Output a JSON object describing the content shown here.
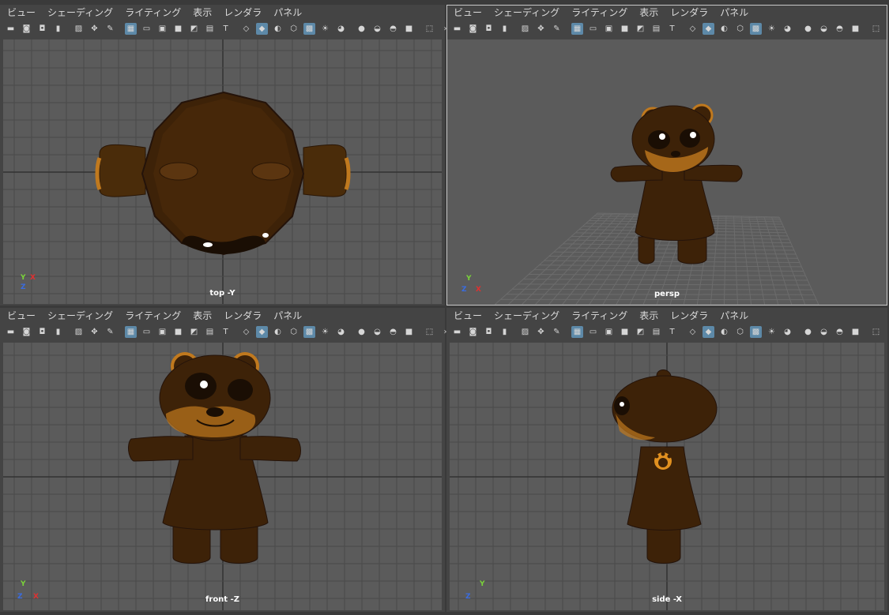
{
  "menu": [
    "ビュー",
    "シェーディング",
    "ライティング",
    "表示",
    "レンダラ",
    "パネル"
  ],
  "toolbar_icons": [
    {
      "name": "camera-icon",
      "glyph": "▬",
      "on": false
    },
    {
      "name": "camera-attributes-icon",
      "glyph": "◙",
      "on": false
    },
    {
      "name": "camera-lock-icon",
      "glyph": "◘",
      "on": false
    },
    {
      "name": "bookmark-icon",
      "glyph": "▮",
      "on": false
    },
    {
      "sep": true
    },
    {
      "name": "image-plane-icon",
      "glyph": "▨",
      "on": false
    },
    {
      "name": "pan-zoom-icon",
      "glyph": "✥",
      "on": false
    },
    {
      "name": "grease-pencil-icon",
      "glyph": "✎",
      "on": false
    },
    {
      "sep": true
    },
    {
      "name": "grid-icon",
      "glyph": "▦",
      "on": true
    },
    {
      "name": "film-gate-icon",
      "glyph": "▭",
      "on": false
    },
    {
      "name": "resolution-gate-icon",
      "glyph": "▣",
      "on": false
    },
    {
      "name": "gate-mask-icon",
      "glyph": "■",
      "on": false
    },
    {
      "name": "field-chart-icon",
      "glyph": "◩",
      "on": false
    },
    {
      "name": "safe-action-icon",
      "glyph": "▤",
      "on": false
    },
    {
      "name": "safe-title-icon",
      "glyph": "T",
      "on": false
    },
    {
      "sep": true
    },
    {
      "name": "wireframe-icon",
      "glyph": "◇",
      "on": false
    },
    {
      "name": "smooth-shade-icon",
      "glyph": "◆",
      "on": true
    },
    {
      "name": "default-material-icon",
      "glyph": "◐",
      "on": false
    },
    {
      "name": "wireframe-on-shaded-icon",
      "glyph": "⬡",
      "on": false
    },
    {
      "name": "textured-icon",
      "glyph": "▩",
      "on": true
    },
    {
      "name": "use-all-lights-icon",
      "glyph": "☀",
      "on": false
    },
    {
      "name": "shadows-icon",
      "glyph": "◕",
      "on": false
    },
    {
      "sep": true
    },
    {
      "name": "isolate-select-icon",
      "glyph": "●",
      "on": false
    },
    {
      "name": "xray-icon",
      "glyph": "◒",
      "on": false
    },
    {
      "name": "xray-joints-icon",
      "glyph": "◓",
      "on": false
    },
    {
      "name": "xray-active-components-icon",
      "glyph": "■",
      "on": false
    },
    {
      "sep": true
    },
    {
      "name": "select-camera-icon",
      "glyph": "⬚",
      "on": false
    },
    {
      "name": "more-icon",
      "glyph": "›",
      "on": false
    }
  ],
  "panels": {
    "top": {
      "label": "top -Y",
      "axis": {
        "up": "Y",
        "right": "X",
        "down": "Z"
      }
    },
    "persp": {
      "label": "persp",
      "axis": {
        "up": "Y",
        "right": "X",
        "down": "Z"
      }
    },
    "front": {
      "label": "front -Z",
      "axis": {
        "up": "Y",
        "right": "X",
        "down": "Z"
      }
    },
    "side": {
      "label": "side -X",
      "axis": {
        "up": "Y",
        "right": "",
        "down": "Z"
      }
    }
  },
  "colors": {
    "viewport_bg": "#5b5b5b",
    "grid": "#4a4a4a",
    "grid_axis": "#333333",
    "fur_dark": "#2a1605",
    "fur": "#4a2c0a",
    "fur_light": "#c0791e",
    "eye": "#ffffff",
    "active_icon": "#5d89a8"
  }
}
